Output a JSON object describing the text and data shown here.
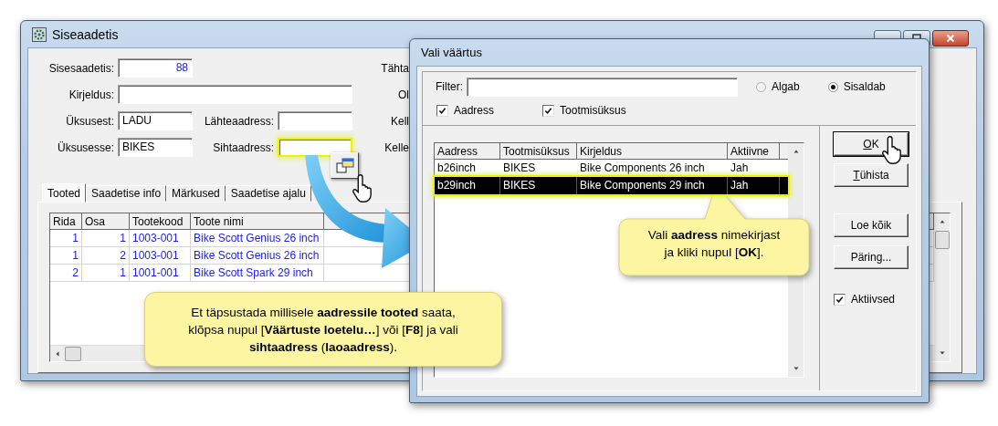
{
  "main_window": {
    "title": "Siseaadetis",
    "form": [
      [
        {
          "label": "Sisesaadetis:",
          "value": "88",
          "kind": "number",
          "highlighted": false
        }
      ],
      [
        {
          "label": "Kirjeldus:",
          "kind": "wide",
          "highlighted": false
        }
      ],
      [
        {
          "label": "Üksusest:",
          "value": "LADU",
          "kind": "text",
          "highlighted": false
        },
        {
          "label": "Lähteaadress:",
          "kind": "text",
          "highlighted": false
        }
      ],
      [
        {
          "label": "Üksusesse:",
          "value": "BIKES",
          "kind": "text",
          "highlighted": false
        },
        {
          "label": "Sihtaadress:",
          "kind": "text",
          "highlighted": true
        }
      ]
    ],
    "side_labels": [
      "Tähta",
      "Ol",
      "Kell",
      "Kelle"
    ],
    "tabs": [
      {
        "label": "Tooted",
        "selected": true
      },
      {
        "label": "Saadetise info",
        "selected": false
      },
      {
        "label": "Märkused",
        "selected": false
      },
      {
        "label": "Saadetise ajalu",
        "selected": false
      }
    ],
    "table": {
      "columns": [
        {
          "label": "Rida",
          "kind": "number"
        },
        {
          "label": "Osa",
          "kind": "number"
        },
        {
          "label": "Tootekood",
          "kind": "text"
        },
        {
          "label": "Toote nimi",
          "kind": "text"
        }
      ],
      "rows": [
        [
          "1",
          "1",
          "1003-001",
          "Bike Scott Genius 26 inch"
        ],
        [
          "1",
          "2",
          "1003-001",
          "Bike Scott Genius 26 inch"
        ],
        [
          "2",
          "1",
          "1001-001",
          "Bike Scott Spark 29 inch"
        ]
      ]
    }
  },
  "dialog": {
    "title": "Vali väärtus",
    "filter": {
      "label": "Filter:"
    },
    "match_options": [
      {
        "label": "Algab",
        "selected": false
      },
      {
        "label": "Sisaldab",
        "selected": true
      }
    ],
    "search_columns": [
      {
        "label": "Aadress",
        "checked": true
      },
      {
        "label": "Tootmisüksus",
        "checked": true
      }
    ],
    "table": {
      "columns": [
        "Aadress",
        "Tootmisüksus",
        "Kirjeldus",
        "Aktiivne"
      ],
      "rows": [
        {
          "cells": [
            "b26inch",
            "BIKES",
            "Bike Components 26 inch",
            "Jah"
          ],
          "selected": false
        },
        {
          "cells": [
            "b29inch",
            "BIKES",
            "Bike Components 29 inch",
            "Jah"
          ],
          "selected": true
        }
      ]
    },
    "buttons": [
      {
        "label": "OK",
        "mnemonic": true
      },
      {
        "label": "Tühista",
        "mnemonic": true
      },
      {
        "label": "Loe kõik",
        "mnemonic": false
      },
      {
        "label": "Päring...",
        "mnemonic": false
      }
    ],
    "active_only": {
      "label": "Aktiivsed",
      "checked": true
    }
  },
  "callouts": [
    {
      "text": "Et täpsustada millisele **aadressile tooted** saata, klõpsa nupul [**Väärtuste loetelu…**] või [**F8**] ja vali **sihtaadress** (**laoaadress**)."
    },
    {
      "text": "Vali **aadress** nimekirjast ja kliki nupul [**OK**]."
    }
  ]
}
